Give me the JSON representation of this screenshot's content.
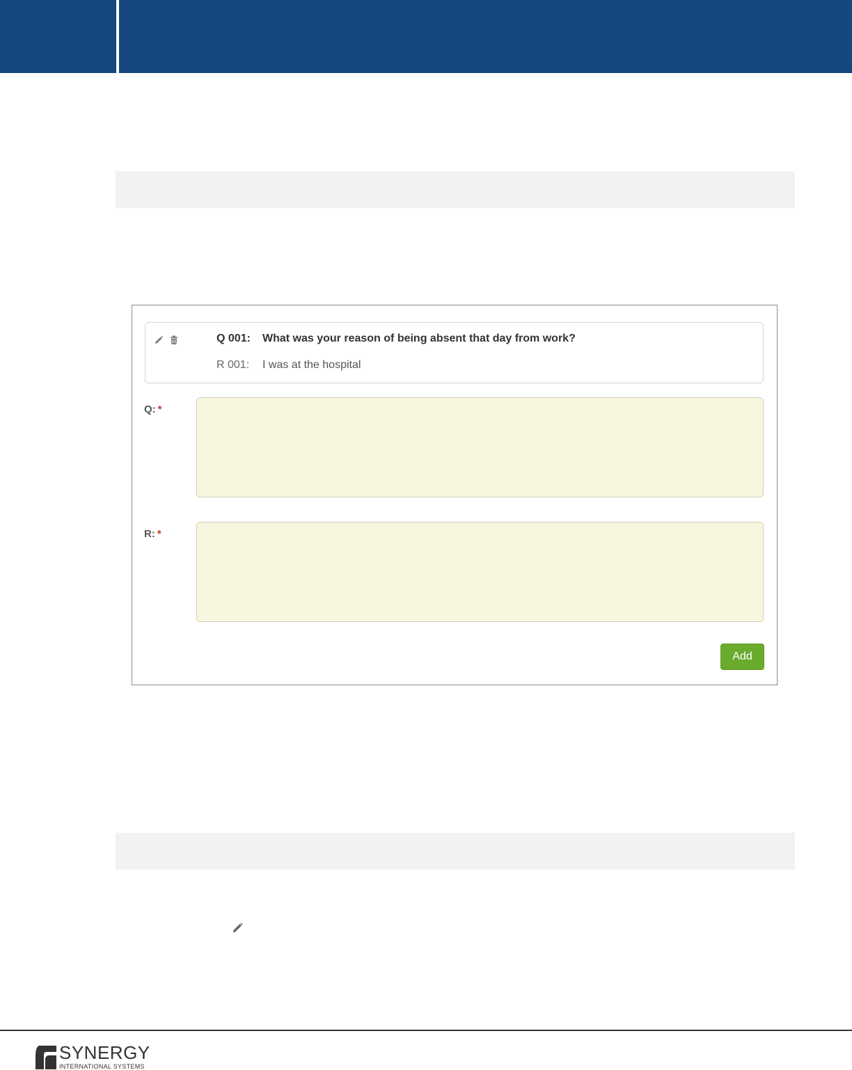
{
  "card": {
    "question_prefix": "Q 001:",
    "question_text": "What was your reason of being absent that day from work?",
    "response_prefix": "R 001:",
    "response_text": "I was at the hospital"
  },
  "form": {
    "question_label": "Q:",
    "response_label": "R:",
    "required_marker": "*",
    "question_value": "",
    "response_value": "",
    "add_label": "Add"
  },
  "icons": {
    "card_edit": "pencil-icon",
    "card_delete": "trash-icon",
    "inline_edit": "pencil-icon"
  },
  "colors": {
    "header": "#15467e",
    "field_background": "#f8f6df",
    "add_button": "#6aab2e",
    "required": "#c0392b"
  },
  "footer": {
    "logo_word": "SYNERGY",
    "logo_subtitle": "INTERNATIONAL SYSTEMS"
  }
}
